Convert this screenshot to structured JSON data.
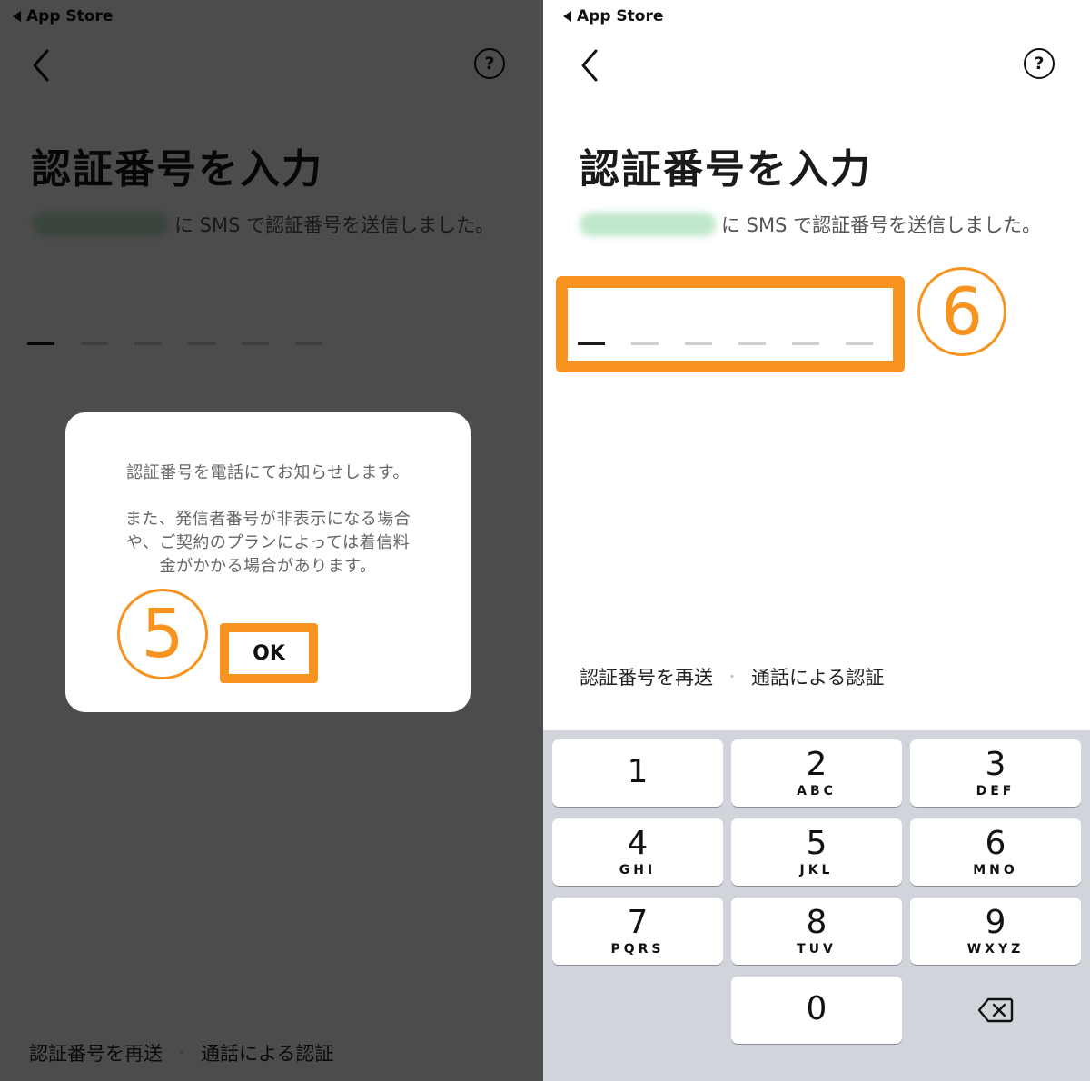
{
  "status_bar": {
    "back_label": "App Store"
  },
  "page": {
    "title": "認証番号を入力",
    "sms_message": "に SMS で認証番号を送信しました。",
    "resend_link": "認証番号を再送",
    "call_auth_link": "通話による認証",
    "link_separator": "・"
  },
  "help": {
    "label": "?"
  },
  "dialog": {
    "line1": "認証番号を電話にてお知らせします。",
    "line2": "また、発信者番号が非表示になる場合",
    "line3": "や、ご契約のプランによっては着信料",
    "line4": "金がかかる場合があります。",
    "ok_label": "OK"
  },
  "annotations": {
    "step5": "5",
    "step6": "6",
    "highlight_color": "#f7931e"
  },
  "keyboard": {
    "keys": [
      {
        "digit": "1",
        "letters": ""
      },
      {
        "digit": "2",
        "letters": "ABC"
      },
      {
        "digit": "3",
        "letters": "DEF"
      },
      {
        "digit": "4",
        "letters": "GHI"
      },
      {
        "digit": "5",
        "letters": "JKL"
      },
      {
        "digit": "6",
        "letters": "MNO"
      },
      {
        "digit": "7",
        "letters": "PQRS"
      },
      {
        "digit": "8",
        "letters": "TUV"
      },
      {
        "digit": "9",
        "letters": "WXYZ"
      },
      {
        "digit": "0",
        "letters": ""
      }
    ],
    "delete_icon": "backspace-icon"
  }
}
